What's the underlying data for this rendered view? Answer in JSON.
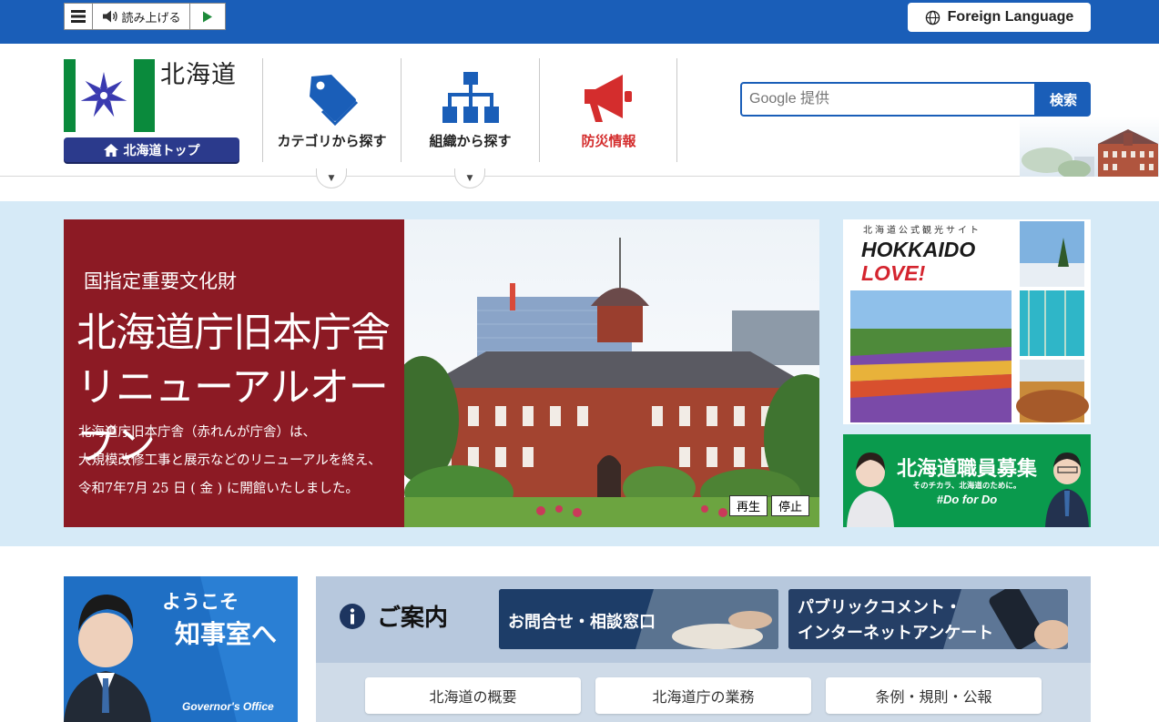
{
  "topbar": {
    "read_aloud_label": "読み上げる",
    "foreign_language_label": "Foreign Language"
  },
  "header": {
    "pref_name": "北海道",
    "home_label": "北海道トップ",
    "nav": [
      {
        "label": "カテゴリから探す",
        "icon": "tag-icon"
      },
      {
        "label": "組織から探す",
        "icon": "org-chart-icon"
      },
      {
        "label": "防災情報",
        "icon": "megaphone-icon"
      }
    ],
    "search": {
      "placeholder": "Google 提供",
      "button_label": "検索"
    }
  },
  "hero": {
    "subtitle": "国指定重要文化財",
    "title_line1": "北海道庁旧本庁舎",
    "title_line2": "リニューアルオープン",
    "body_lines": [
      "北海道庁旧本庁舎（赤れんが庁舎）は、",
      "大規模改修工事と展示などのリニューアルを終え、",
      "令和7年7月 25 日 ( 金 ) に開館いたしました。"
    ],
    "play_label": "再生",
    "stop_label": "停止"
  },
  "banners": {
    "hokkaido_love": {
      "kicker": "北海道公式観光サイト",
      "line1": "HOKKAIDO",
      "line2": "LOVE!"
    },
    "recruit": {
      "title": "北海道職員募集",
      "sub": "そのチカラ、北海道のために。",
      "tag": "#Do for Do"
    }
  },
  "governor": {
    "line1": "ようこそ",
    "line2": "知事室へ",
    "caption": "Governor's Office"
  },
  "annai": {
    "title": "ご案内",
    "contact_label": "お問合せ・相談窓口",
    "public_comment_line1": "パブリックコメント・",
    "public_comment_line2": "インターネットアンケート",
    "links": [
      "北海道の概要",
      "北海道庁の業務",
      "条例・規則・公報"
    ]
  },
  "colors": {
    "brand_blue": "#1a5eb8",
    "hero_red": "#8c1a24",
    "band_blue": "#d6eaf7",
    "recruit_green": "#0a9a4d",
    "disaster_red": "#d42d2d"
  }
}
